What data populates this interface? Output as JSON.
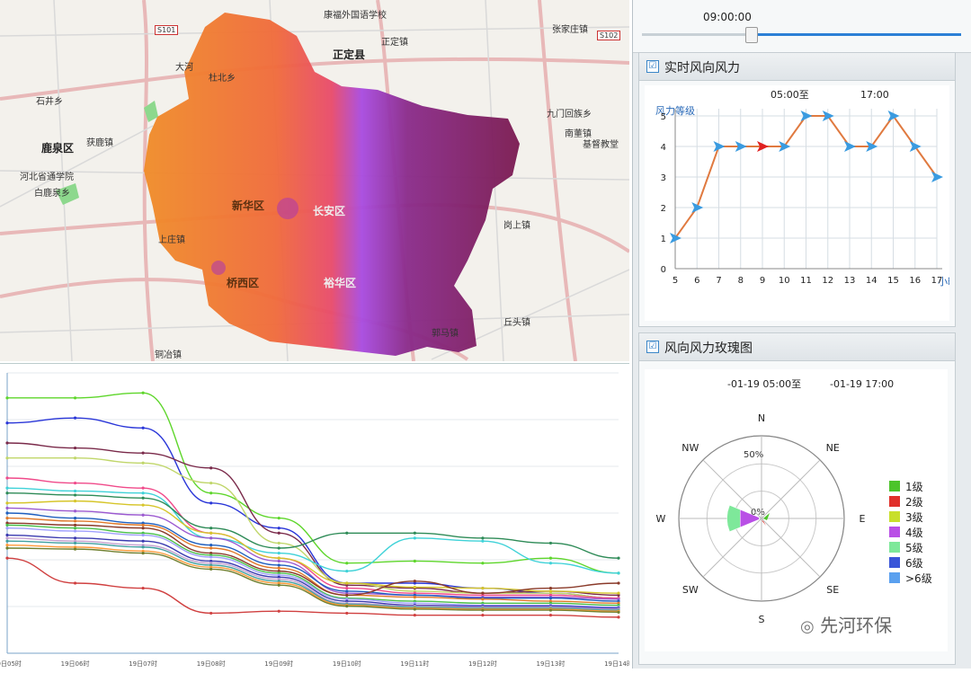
{
  "map": {
    "labels": {
      "school": "康福外国语学校",
      "zhengding_town": "正定镇",
      "zhengding_county": "正定县",
      "zhangjiazhuang": "张家庄镇",
      "s101": "S101",
      "s102": "S102",
      "dahe": "大河",
      "shibei": "杜北乡",
      "shijing": "石井乡",
      "jiumenhui": "九门回族乡",
      "nanrong": "南董镇",
      "jiyingyi": "基督教堂",
      "luquan": "鹿泉区",
      "huolu": "获鹿镇",
      "hebei_school": "河北省通学院",
      "bailuquan": "白鹿泉乡",
      "xinhua": "新华区",
      "qiaoxi": "桥西区",
      "changan": "长安区",
      "yuhua": "裕华区",
      "gangshang": "岗上镇",
      "shangzhuang": "上庄镇",
      "qiutou": "丘头镇",
      "dongtai": "铜冶镇",
      "yema": "郭马镇"
    }
  },
  "timeline": {
    "time": "09:00:00",
    "progress": 0.34
  },
  "wind_panel": {
    "title": "实时风向风力",
    "checkbox": "☑",
    "range_start": "05:00至",
    "range_end": "17:00",
    "y_axis_label": "风力等级",
    "x_axis_unit": "小时",
    "line_color": "#e07a40",
    "arrow_color": "#3a9be0",
    "highlight_color": "#e02020"
  },
  "rose_panel": {
    "title": "风向风力玫瑰图",
    "checkbox": "☑",
    "range": "-01-19 05:00至",
    "range_end": "-01-19 17:00",
    "directions": [
      "N",
      "NE",
      "E",
      "SE",
      "S",
      "SW",
      "W",
      "NW"
    ],
    "pct_50": "50%",
    "pct_0": "0%",
    "legend": [
      {
        "label": "1级",
        "color": "#4cc42b"
      },
      {
        "label": "2级",
        "color": "#e0302a"
      },
      {
        "label": "3级",
        "color": "#c8df2a"
      },
      {
        "label": "4级",
        "color": "#b94fe6"
      },
      {
        "label": "5级",
        "color": "#7ee89a"
      },
      {
        "label": "6级",
        "color": "#3a55d8"
      },
      {
        "label": ">6级",
        "color": "#5aa0ef"
      }
    ]
  },
  "watermark": "先河环保",
  "line_chart_axis": {
    "x_ticks": [
      "19日05时",
      "19日06时",
      "19日07时",
      "19日08时",
      "19日09时",
      "19日10时",
      "19日11时",
      "19日12时",
      "19日13时",
      "19日14时"
    ]
  },
  "chart_data": [
    {
      "type": "line",
      "x": [
        5,
        6,
        7,
        8,
        9,
        10,
        11,
        12,
        13,
        14,
        15,
        16,
        17
      ],
      "series": [
        {
          "values": [
            1,
            2,
            4,
            4,
            4,
            4,
            5,
            5,
            4,
            4,
            5,
            4,
            3
          ]
        }
      ],
      "xlabel": "小时",
      "ylabel": "风力等级",
      "ylim": [
        0,
        5
      ],
      "xlim": [
        5,
        17
      ],
      "y_ticks": [
        0,
        1,
        2,
        3,
        4,
        5
      ],
      "grid": true
    },
    {
      "type": "line",
      "x": [
        0,
        1,
        2,
        3,
        4,
        5,
        6,
        7,
        8,
        9
      ],
      "series": [
        {
          "color": "#5ed62b",
          "values": [
            255,
            255,
            260,
            160,
            135,
            90,
            92,
            90,
            95,
            80
          ]
        },
        {
          "color": "#2a36d8",
          "values": [
            230,
            235,
            225,
            150,
            125,
            70,
            70,
            65,
            60,
            55
          ]
        },
        {
          "color": "#7a2a4a",
          "values": [
            210,
            205,
            200,
            185,
            120,
            68,
            65,
            60,
            62,
            58
          ]
        },
        {
          "color": "#c0d66a",
          "values": [
            195,
            195,
            190,
            170,
            110,
            70,
            62,
            60,
            60,
            55
          ]
        },
        {
          "color": "#f04a8a",
          "values": [
            175,
            170,
            165,
            120,
            95,
            65,
            60,
            58,
            58,
            55
          ]
        },
        {
          "color": "#3fd2d8",
          "values": [
            165,
            162,
            160,
            115,
            100,
            82,
            115,
            112,
            90,
            80
          ]
        },
        {
          "color": "#2e8b57",
          "values": [
            160,
            158,
            155,
            125,
            105,
            120,
            120,
            115,
            110,
            95
          ]
        },
        {
          "color": "#d6c52a",
          "values": [
            150,
            152,
            148,
            120,
            95,
            70,
            66,
            65,
            62,
            60
          ]
        },
        {
          "color": "#9b59d0",
          "values": [
            145,
            142,
            138,
            115,
            92,
            60,
            58,
            56,
            56,
            54
          ]
        },
        {
          "color": "#1f5fbf",
          "values": [
            140,
            135,
            130,
            108,
            88,
            62,
            58,
            55,
            55,
            52
          ]
        },
        {
          "color": "#e07a2a",
          "values": [
            135,
            132,
            128,
            105,
            85,
            58,
            56,
            54,
            52,
            50
          ]
        },
        {
          "color": "#8a3a2a",
          "values": [
            130,
            128,
            125,
            100,
            82,
            58,
            72,
            60,
            65,
            70
          ]
        },
        {
          "color": "#4ac04a",
          "values": [
            128,
            125,
            120,
            98,
            80,
            55,
            52,
            50,
            50,
            48
          ]
        },
        {
          "color": "#a0a0ff",
          "values": [
            125,
            122,
            118,
            96,
            78,
            54,
            50,
            48,
            48,
            46
          ]
        },
        {
          "color": "#d04040",
          "values": [
            95,
            70,
            65,
            40,
            42,
            40,
            38,
            38,
            38,
            36
          ]
        },
        {
          "color": "#3a3ab0",
          "values": [
            118,
            115,
            112,
            92,
            76,
            52,
            48,
            47,
            47,
            45
          ]
        },
        {
          "color": "#c4a0d0",
          "values": [
            115,
            112,
            108,
            90,
            74,
            50,
            47,
            46,
            46,
            44
          ]
        },
        {
          "color": "#40a0a0",
          "values": [
            112,
            110,
            106,
            88,
            72,
            49,
            46,
            45,
            45,
            43
          ]
        },
        {
          "color": "#ff9a3a",
          "values": [
            108,
            106,
            102,
            86,
            70,
            48,
            45,
            44,
            44,
            42
          ]
        },
        {
          "color": "#708030",
          "values": [
            105,
            104,
            100,
            84,
            68,
            47,
            44,
            43,
            43,
            41
          ]
        }
      ],
      "ylim": [
        0,
        280
      ],
      "grid": true
    },
    {
      "type": "pie",
      "categories": [
        "W"
      ],
      "values": [
        0.38
      ],
      "legend": [
        "1级",
        "2级",
        "3级",
        "4级",
        "5级",
        "6级",
        ">6级"
      ]
    }
  ]
}
